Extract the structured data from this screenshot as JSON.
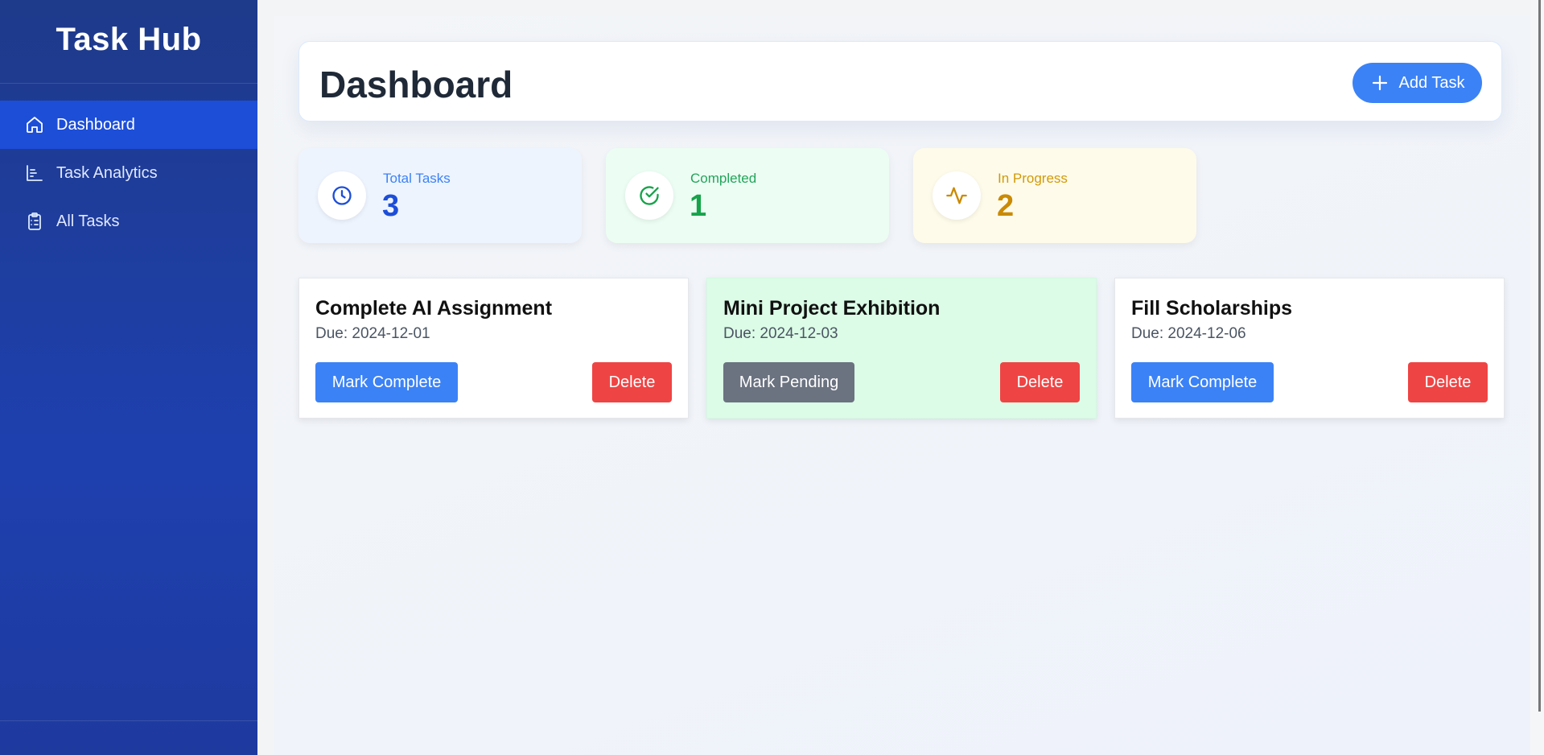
{
  "app": {
    "title": "Task Hub"
  },
  "sidebar": {
    "items": [
      {
        "label": "Dashboard",
        "icon": "home-icon",
        "active": true
      },
      {
        "label": "Task Analytics",
        "icon": "bar-chart-icon",
        "active": false
      },
      {
        "label": "All Tasks",
        "icon": "clipboard-list-icon",
        "active": false
      }
    ]
  },
  "header": {
    "title": "Dashboard",
    "add_label": "Add Task"
  },
  "stats": [
    {
      "label": "Total Tasks",
      "value": "3",
      "icon": "clock-icon",
      "color": "#1d4ed8"
    },
    {
      "label": "Completed",
      "value": "1",
      "icon": "check-circle-icon",
      "color": "#16a34a"
    },
    {
      "label": "In Progress",
      "value": "2",
      "icon": "activity-icon",
      "color": "#ca8a04"
    }
  ],
  "tasks": [
    {
      "title": "Complete AI Assignment",
      "due": "Due: 2024-12-01",
      "action": "Mark Complete",
      "delete": "Delete",
      "completed": false
    },
    {
      "title": "Mini Project Exhibition",
      "due": "Due: 2024-12-03",
      "action": "Mark Pending",
      "delete": "Delete",
      "completed": true
    },
    {
      "title": "Fill Scholarships",
      "due": "Due: 2024-12-06",
      "action": "Mark Complete",
      "delete": "Delete",
      "completed": false
    }
  ],
  "colors": {
    "sidebar": "#1e40af",
    "active_item": "#1d4ed8",
    "primary": "#3b82f6",
    "danger": "#ef4444",
    "secondary": "#6b7280",
    "completed_card": "#dcfce7"
  }
}
